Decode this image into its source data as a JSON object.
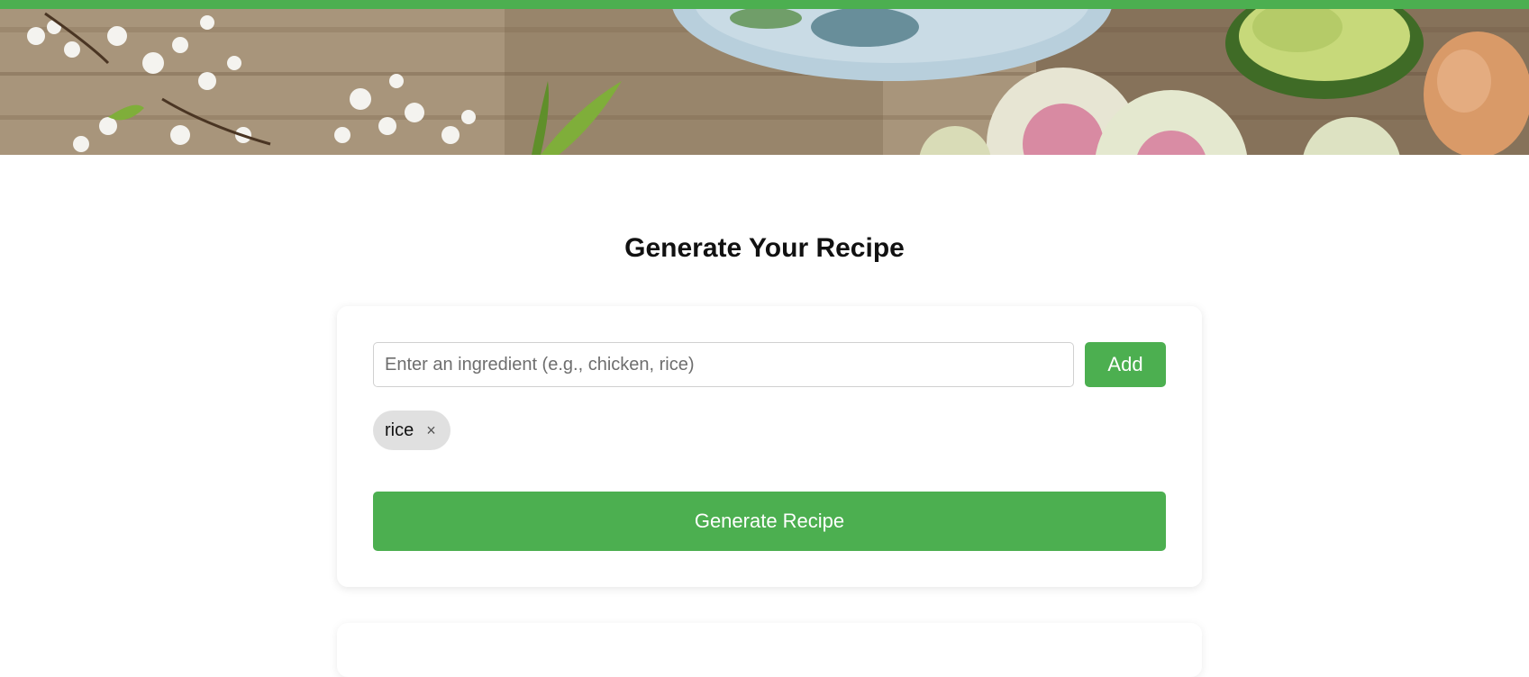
{
  "header": {
    "accent_color": "#4caf50",
    "banner_icon": "food-banner-image"
  },
  "main": {
    "title": "Generate Your Recipe"
  },
  "form": {
    "input_placeholder": "Enter an ingredient (e.g., chicken, rice)",
    "input_value": "",
    "add_label": "Add",
    "ingredients": [
      {
        "label": "rice",
        "remove_symbol": "×"
      }
    ],
    "generate_label": "Generate Recipe"
  }
}
